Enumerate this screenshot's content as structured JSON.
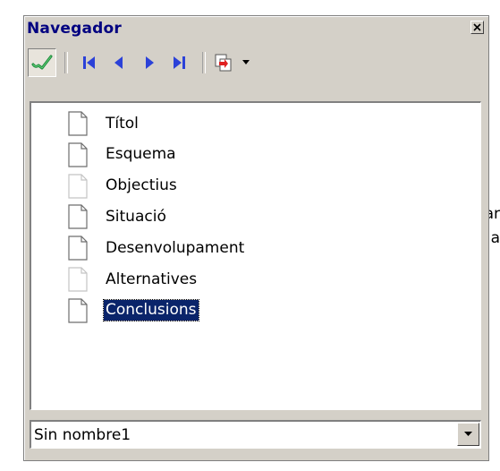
{
  "background": {
    "fragments": [
      "ar",
      "a"
    ]
  },
  "navigator": {
    "title": "Navegador",
    "toolbar": {
      "buttons": [
        {
          "icon": "pointer-toggle-icon",
          "pressed": true
        },
        {
          "icon": "first-slide-icon"
        },
        {
          "icon": "previous-slide-icon"
        },
        {
          "icon": "next-slide-icon"
        },
        {
          "icon": "last-slide-icon"
        },
        {
          "icon": "drag-mode-icon"
        }
      ]
    },
    "tree": {
      "items": [
        {
          "label": "Títol",
          "selected": false,
          "icon": "page-icon"
        },
        {
          "label": "Esquema",
          "selected": false,
          "icon": "page-icon"
        },
        {
          "label": "Objectius",
          "selected": false,
          "icon": "page-icon-faded"
        },
        {
          "label": "Situació",
          "selected": false,
          "icon": "page-icon"
        },
        {
          "label": "Desenvolupament",
          "selected": false,
          "icon": "page-icon"
        },
        {
          "label": "Alternatives",
          "selected": false,
          "icon": "page-icon-faded"
        },
        {
          "label": "Conclusions",
          "selected": true,
          "icon": "page-icon"
        }
      ]
    },
    "document_select": {
      "value": "Sin nombre1"
    }
  },
  "colors": {
    "title_text": "#000080",
    "nav_arrows": "#2b41d8",
    "selection": "#0a246a",
    "panel_bg": "#d4d0c8"
  }
}
